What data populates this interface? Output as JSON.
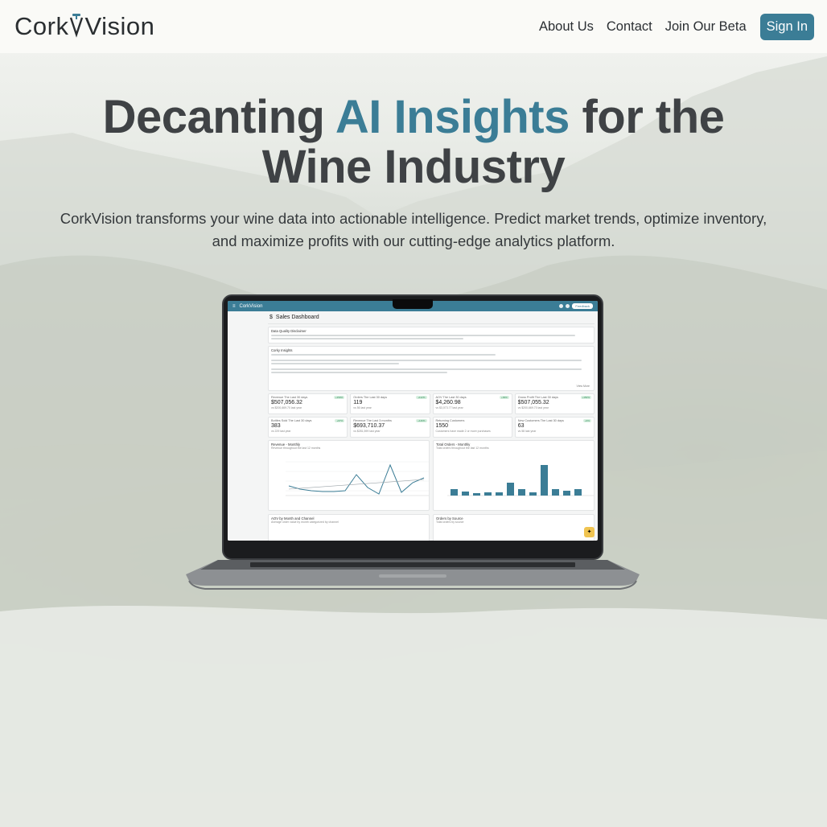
{
  "nav": {
    "logo_left": "Cork",
    "logo_right": "Vision",
    "links": [
      "About Us",
      "Contact",
      "Join Our Beta"
    ],
    "signin": "Sign In"
  },
  "hero": {
    "title_part1": "Decanting ",
    "title_accent": "AI Insights",
    "title_part2": " for the",
    "title_line2": "Wine Industry",
    "subtitle": "CorkVision transforms your wine data into actionable intelligence. Predict market trends, optimize inventory, and maximize profits with our cutting-edge analytics platform."
  },
  "dashboard": {
    "app_name": "CorkVision",
    "title": "Sales Dashboard",
    "disclaimer_title": "Data Quality Disclaimer",
    "insights_title": "Corky Insights",
    "view_more": "View More",
    "feedback": "Feedback",
    "kpis": [
      {
        "label": "Revenue The Last 30 days",
        "value": "$507,056.32",
        "sub": "vs $200,669.70 last year",
        "badge": "+150%"
      },
      {
        "label": "Orders The Last 30 days",
        "value": "119",
        "sub": "vs 56 last year",
        "badge": "+112%"
      },
      {
        "label": "AOV The Last 30 days",
        "value": "$4,260.98",
        "sub": "vs $3,073.77 last year",
        "badge": "+39%"
      },
      {
        "label": "Gross Profit The Last 30 days",
        "value": "$507,055.32",
        "sub": "vs $200,669.70 last year",
        "badge": "+150%"
      },
      {
        "label": "Bottles Sold The Last 30 days",
        "value": "383",
        "sub": "vs 229 last year",
        "badge": "+67%"
      },
      {
        "label": "Revenue The Last 3 months",
        "value": "$693,710.37",
        "sub": "vs $281,599 last year",
        "badge": "+146%"
      },
      {
        "label": "Returning Customers",
        "value": "1550",
        "sub": "Customers have made 2 or more purchases",
        "badge": ""
      },
      {
        "label": "New Customers The Last 30 days",
        "value": "63",
        "sub": "vs 58 last year",
        "badge": "+9%"
      }
    ],
    "chart1": {
      "title": "Revenue - Monthly",
      "subtitle": "Revenue throughout the last 12 months"
    },
    "chart2": {
      "title": "Total Orders - Monthly",
      "subtitle": "Total orders throughout the last 12 months"
    },
    "chart3": {
      "title": "AOV by Month and Channel",
      "subtitle": "Average order value by month categorized by channel"
    },
    "chart4": {
      "title": "Orders by Source",
      "subtitle": "Total orders by source"
    }
  },
  "colors": {
    "accent": "#3b7d96",
    "title_text": "#3f4245"
  }
}
